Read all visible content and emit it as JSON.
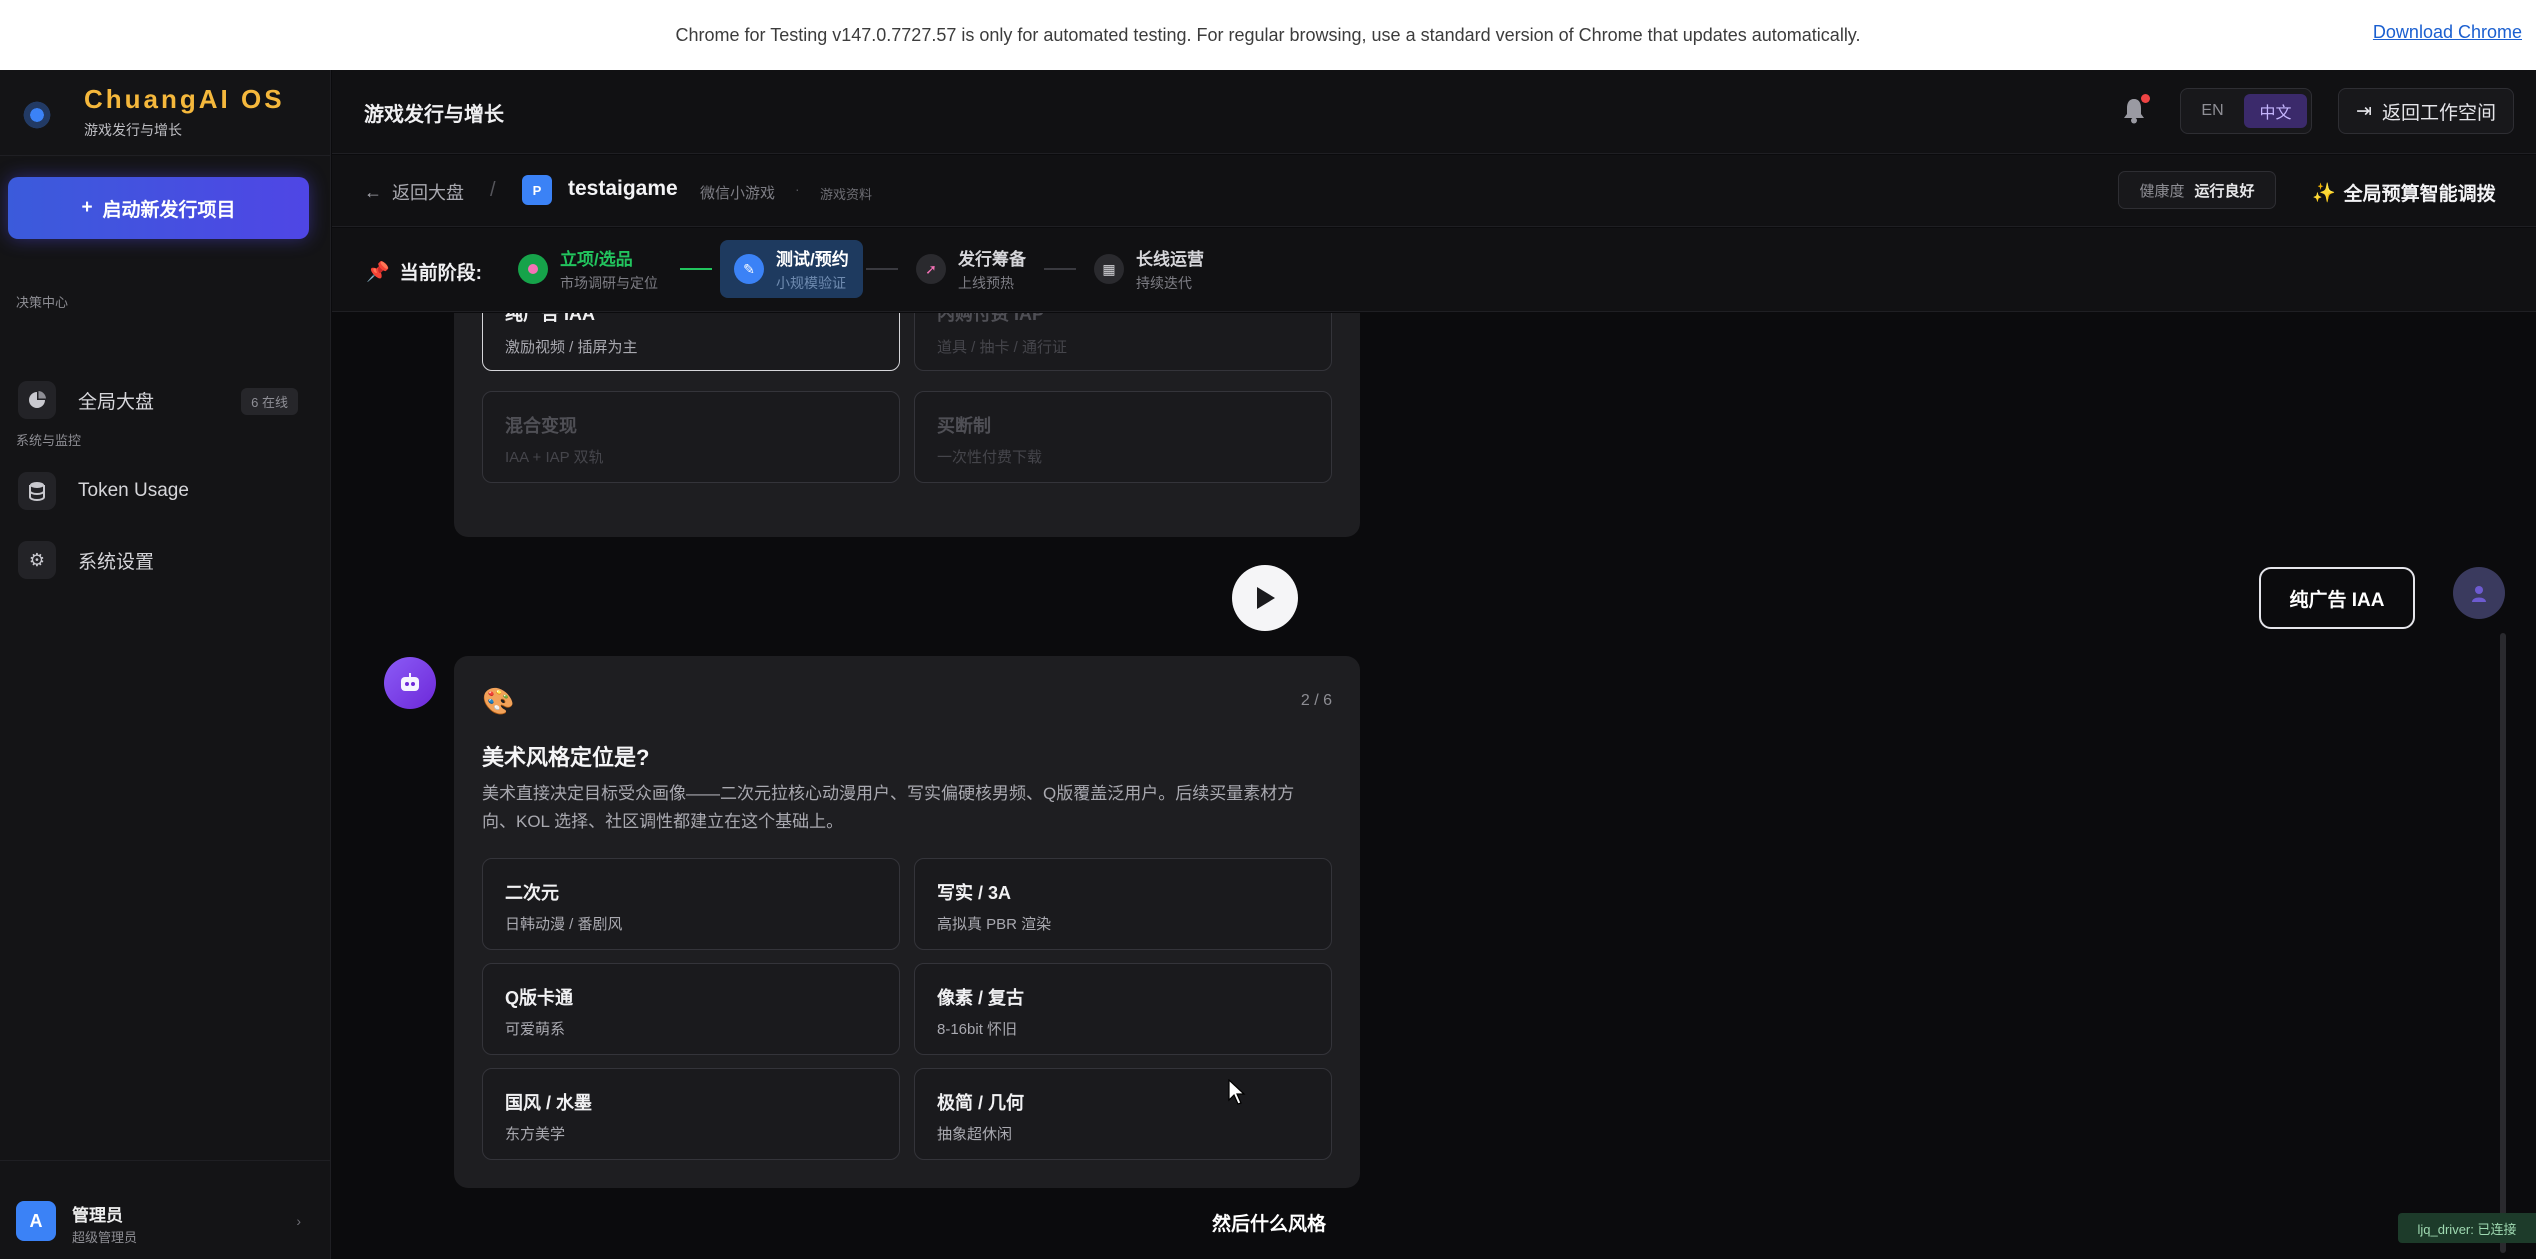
{
  "banner": {
    "message": "Chrome for Testing v147.0.7727.57 is only for automated testing. For regular browsing, use a standard version of Chrome that updates automatically.",
    "download_link": "Download Chrome"
  },
  "sidebar": {
    "brand_name": "ChuangAI OS",
    "brand_sub": "游戏发行与增长",
    "launch_button": "启动新发行项目",
    "section_decision": "决策中心",
    "section_system": "系统与监控",
    "items": [
      {
        "label": "全局大盘",
        "badge": "6 在线",
        "icon": "pie-chart-icon"
      },
      {
        "label": "Token Usage",
        "icon": "database-icon"
      },
      {
        "label": "系统设置",
        "icon": "gear-icon"
      }
    ],
    "user": {
      "avatar": "A",
      "name": "管理员",
      "role": "超级管理员"
    }
  },
  "header": {
    "title": "游戏发行与增长",
    "lang_en": "EN",
    "lang_zh": "中文",
    "back_workspace": "返回工作空间"
  },
  "project": {
    "back": "返回大盘",
    "icon_letter": "P",
    "name": "testaigame",
    "platform": "微信小游戏",
    "tag": "游戏资料",
    "health_label": "健康度",
    "health_value": "运行良好",
    "budget_button": "全局预算智能调拨"
  },
  "stages": {
    "label": "当前阶段:",
    "items": [
      {
        "name": "立项/选品",
        "sub": "市场调研与定位",
        "state": "done"
      },
      {
        "name": "测试/预约",
        "sub": "小规模验证",
        "state": "active"
      },
      {
        "name": "发行筹备",
        "sub": "上线预热",
        "state": "pending"
      },
      {
        "name": "长线运营",
        "sub": "持续迭代",
        "state": "pending"
      }
    ]
  },
  "prev_question": {
    "options": [
      {
        "title": "纯广告 IAA",
        "sub": "激励视频 / 插屏为主",
        "state": "selected"
      },
      {
        "title": "内购付费 IAP",
        "sub": "道具 / 抽卡 / 通行证",
        "state": "dim"
      },
      {
        "title": "混合变现",
        "sub": "IAA + IAP 双轨",
        "state": "dim"
      },
      {
        "title": "买断制",
        "sub": "一次性付费下载",
        "state": "dim"
      }
    ],
    "user_answer": "纯广告 IAA"
  },
  "question": {
    "progress": "2 / 6",
    "title": "美术风格定位是?",
    "description": "美术直接决定目标受众画像——二次元拉核心动漫用户、写实偏硬核男频、Q版覆盖泛用户。后续买量素材方向、KOL 选择、社区调性都建立在这个基础上。",
    "options": [
      {
        "title": "二次元",
        "sub": "日韩动漫 / 番剧风"
      },
      {
        "title": "写实 / 3A",
        "sub": "高拟真 PBR 渲染"
      },
      {
        "title": "Q版卡通",
        "sub": "可爱萌系"
      },
      {
        "title": "像素 / 复古",
        "sub": "8-16bit 怀旧"
      },
      {
        "title": "国风 / 水墨",
        "sub": "东方美学"
      },
      {
        "title": "极简 / 几何",
        "sub": "抽象超休闲"
      }
    ]
  },
  "caption": "然后什么风格",
  "driver_badge": "ljq_driver: 已连接",
  "colors": {
    "accent": "#4f46e5",
    "brand": "#f5b83c",
    "done": "#22c55e",
    "active_bg": "#1e3a5f"
  }
}
